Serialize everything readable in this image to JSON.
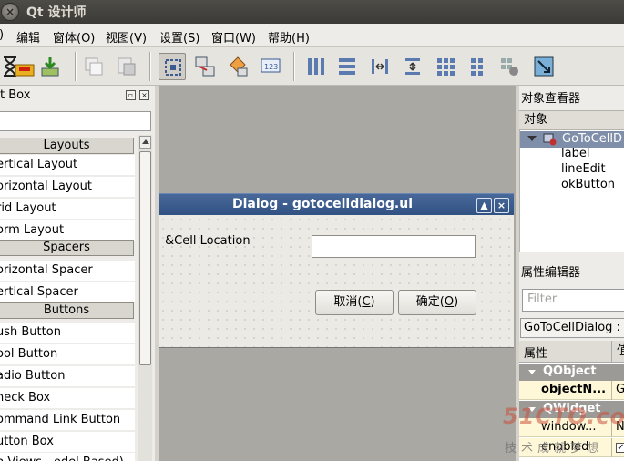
{
  "titlebar": {
    "title": "Qt 设计师",
    "close_glyph": "×"
  },
  "menubar": {
    "items": [
      {
        "label": ")"
      },
      {
        "label": "编辑"
      },
      {
        "label": "窗体(O)"
      },
      {
        "label": "视图(V)"
      },
      {
        "label": "设置(S)"
      },
      {
        "label": "窗口(W)"
      },
      {
        "label": "帮助(H)"
      }
    ]
  },
  "toolbar": {
    "icons": [
      "hourglass-icon",
      "save-icon",
      "copy-icon",
      "paste-icon",
      "edit-widgets-icon",
      "edit-signals-slots-icon",
      "edit-buddies-icon",
      "edit-tab-order-icon",
      "layout-horizontal-icon",
      "layout-vertical-icon",
      "layout-h-splitter-icon",
      "layout-v-splitter-icon",
      "layout-grid-icon",
      "layout-form-icon",
      "break-layout-icon",
      "adjust-size-icon"
    ]
  },
  "widget_box": {
    "title": "t Box",
    "float_glyph": "▫",
    "close_glyph": "×",
    "filter_value": "",
    "rows": [
      {
        "kind": "cat",
        "label": "Layouts"
      },
      {
        "kind": "item",
        "label": "ertical Layout"
      },
      {
        "kind": "item",
        "label": "orizontal Layout"
      },
      {
        "kind": "item",
        "label": "rid Layout"
      },
      {
        "kind": "item",
        "label": "orm Layout"
      },
      {
        "kind": "cat",
        "label": "Spacers"
      },
      {
        "kind": "item",
        "label": "orizontal Spacer"
      },
      {
        "kind": "item",
        "label": "ertical Spacer"
      },
      {
        "kind": "cat",
        "label": "Buttons"
      },
      {
        "kind": "item",
        "label": "ush Button"
      },
      {
        "kind": "item",
        "label": "ool Button"
      },
      {
        "kind": "item",
        "label": "adio Button"
      },
      {
        "kind": "item",
        "label": "heck Box"
      },
      {
        "kind": "item",
        "label": "ommand Link Button"
      },
      {
        "kind": "item",
        "label": "utton Box"
      },
      {
        "kind": "item",
        "label": "n Views - odel Based)"
      }
    ]
  },
  "dialog": {
    "title": "Dialog - gotocelldialog.ui",
    "minimize_glyph": "▲",
    "close_glyph": "×",
    "label": "&Cell Location",
    "line_edit_value": "",
    "cancel": {
      "text": "取消(",
      "mnemonic": "C",
      "suffix": ")"
    },
    "ok": {
      "text": "确定(",
      "mnemonic": "O",
      "suffix": ")"
    }
  },
  "object_inspector": {
    "title": "对象查看器",
    "header": "对象",
    "root": "GoToCellD",
    "children": [
      "label",
      "lineEdit",
      "okButton"
    ]
  },
  "property_editor": {
    "title": "属性编辑器",
    "filter_placeholder": "Filter",
    "class_line": "GoToCellDialog :",
    "col_property": "属性",
    "col_value": "值",
    "groups": [
      {
        "name": "QObject"
      },
      {
        "name": "QWidget"
      }
    ],
    "rows": [
      {
        "key": "objectN...",
        "value": "G"
      },
      {
        "key": "window...",
        "value": "N"
      },
      {
        "key": "enabled",
        "value": "✓"
      }
    ]
  },
  "watermark": {
    "big": "51CTO.com",
    "small": "技术成就梦想"
  }
}
